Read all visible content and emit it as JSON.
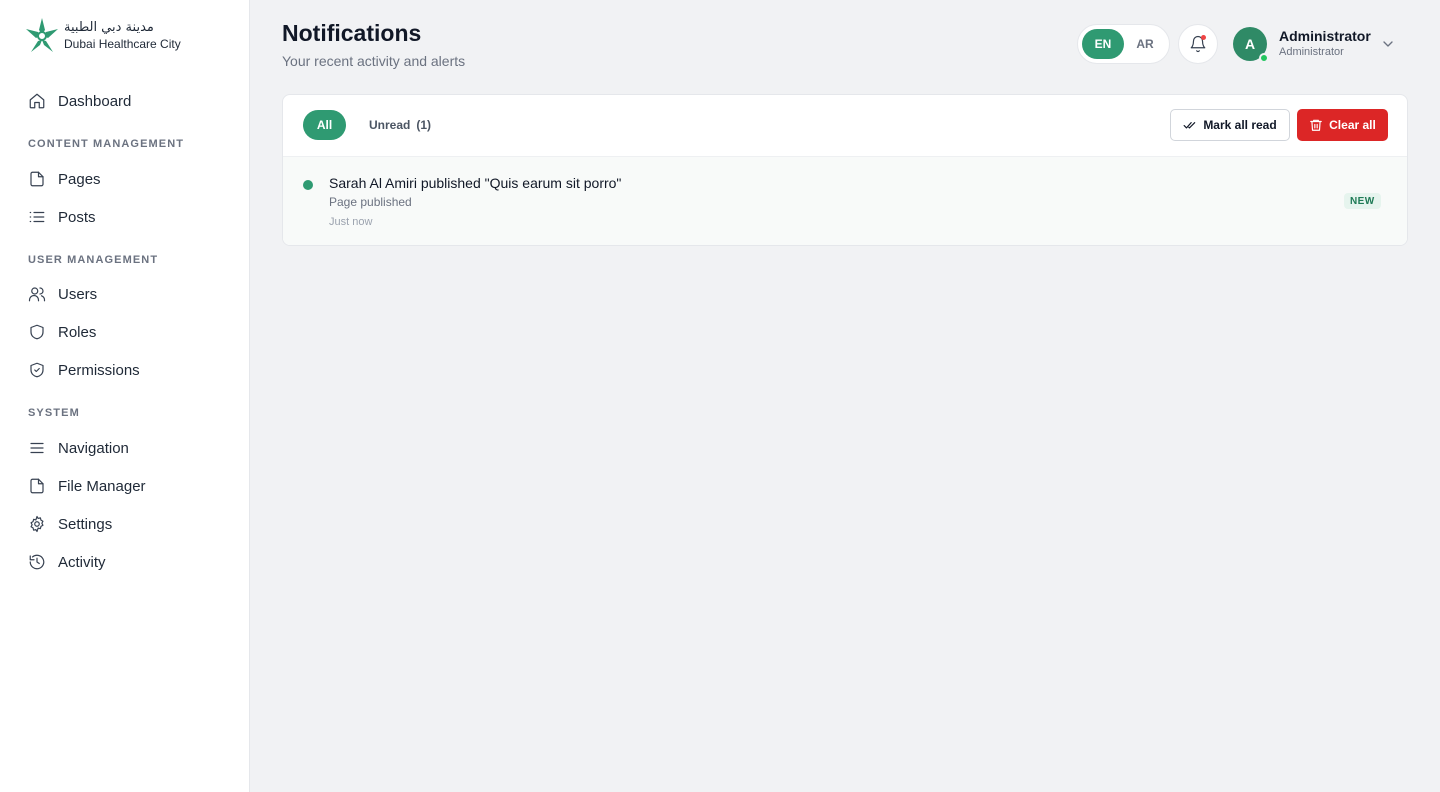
{
  "brand": {
    "name_ar": "مدينة دبي الطبية",
    "name_en": "Dubai Healthcare City",
    "color": "#2f9a72"
  },
  "sidebar": {
    "dashboard": "Dashboard",
    "sections": [
      {
        "title": "CONTENT MANAGEMENT",
        "items": [
          {
            "label": "Pages",
            "icon": "file-icon"
          },
          {
            "label": "Posts",
            "icon": "list-icon"
          }
        ]
      },
      {
        "title": "USER MANAGEMENT",
        "items": [
          {
            "label": "Users",
            "icon": "users-icon"
          },
          {
            "label": "Roles",
            "icon": "shield-icon"
          },
          {
            "label": "Permissions",
            "icon": "shield-check-icon"
          }
        ]
      },
      {
        "title": "SYSTEM",
        "items": [
          {
            "label": "Navigation",
            "icon": "menu-icon"
          },
          {
            "label": "File Manager",
            "icon": "file-icon"
          },
          {
            "label": "Settings",
            "icon": "gear-icon"
          },
          {
            "label": "Activity",
            "icon": "history-icon"
          }
        ]
      }
    ]
  },
  "header": {
    "title": "Notifications",
    "subtitle": "Your recent activity and alerts",
    "lang": {
      "en": "EN",
      "ar": "AR",
      "active": "EN"
    },
    "user": {
      "initial": "A",
      "name": "Administrator",
      "role": "Administrator"
    }
  },
  "notifications": {
    "tabs": {
      "all": "All",
      "unread": "Unread",
      "unread_count": "(1)"
    },
    "actions": {
      "mark_all_read": "Mark all read",
      "clear_all": "Clear all"
    },
    "items": [
      {
        "title": "Sarah Al Amiri published \"Quis earum sit porro\"",
        "subtitle": "Page published",
        "time": "Just now",
        "badge": "NEW"
      }
    ]
  },
  "colors": {
    "accent": "#2f9a72",
    "danger": "#dc2626"
  }
}
